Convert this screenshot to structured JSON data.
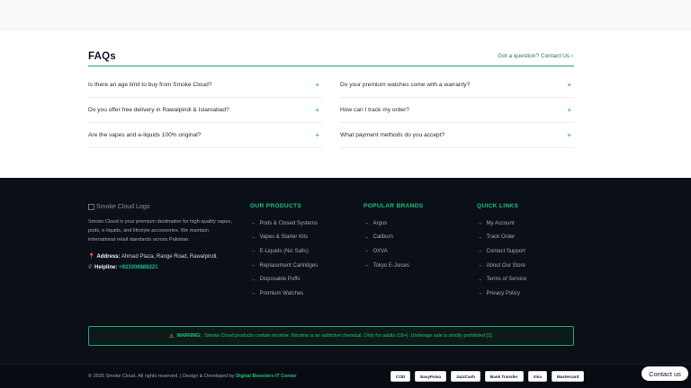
{
  "faq": {
    "title": "FAQs",
    "contact_link": "Got a question? Contact Us ›",
    "items": [
      {
        "q": "Is there an age limit to buy from Smoke Cloud?"
      },
      {
        "q": "Do your premium watches come with a warranty?"
      },
      {
        "q": "Do you offer free delivery in Rawalpindi & Islamabad?"
      },
      {
        "q": "How can I track my order?"
      },
      {
        "q": "Are the vapes and e-liquids 100% original?"
      },
      {
        "q": "What payment methods do you accept?"
      }
    ],
    "expand_symbol": "+"
  },
  "footer": {
    "logo_alt": "Smoke Cloud Logo",
    "about": "Smoke Cloud is your premium destination for high-quality vapes, pods, e-liquids, and lifestyle accessories. We maintain international retail standards across Pakistan.",
    "address_label": "Address:",
    "address_value": "Ahmad Plaza, Range Road, Rawalpindi.",
    "helpline_label": "Helpline:",
    "helpline_value": "+923308888221",
    "columns": [
      {
        "title": "OUR PRODUCTS",
        "links": [
          "Pods & Closed Systems",
          "Vapes & Starter Kits",
          "E-Liquids (Nic Salts)",
          "Replacement Cartridges",
          "Disposable Puffs",
          "Premium Watches"
        ]
      },
      {
        "title": "POPULAR BRANDS",
        "links": [
          "Argus",
          "Caliburn",
          "OXVA",
          "Tokyo E-Juices"
        ]
      },
      {
        "title": "QUICK LINKS",
        "links": [
          "My Account",
          "Track Order",
          "Contact Support",
          "About Our Store",
          "Terms of Service",
          "Privacy Policy"
        ]
      }
    ],
    "link_arrow": "→",
    "warning_label": "WARNING:",
    "warning_text": "Smoke Cloud products contain nicotine. Nicotine is an addictive chemical. Only for adults (18+). Underage sale is strictly prohibited [1].",
    "copyright": "© 2026 Smoke Cloud. All rights reserved. | Design & Developed by",
    "developer": "Digital Boosters IT Center",
    "payments": [
      "COD",
      "EasyPaisa",
      "JazzCash",
      "Bank Transfer",
      "Visa",
      "Mastercard"
    ]
  },
  "widget": {
    "contact_label": "Contact us"
  },
  "colors": {
    "accent": "#19c37d",
    "footer_bg": "#0b0f17",
    "warning_icon": "#facc15",
    "pin": "#ef4444"
  }
}
